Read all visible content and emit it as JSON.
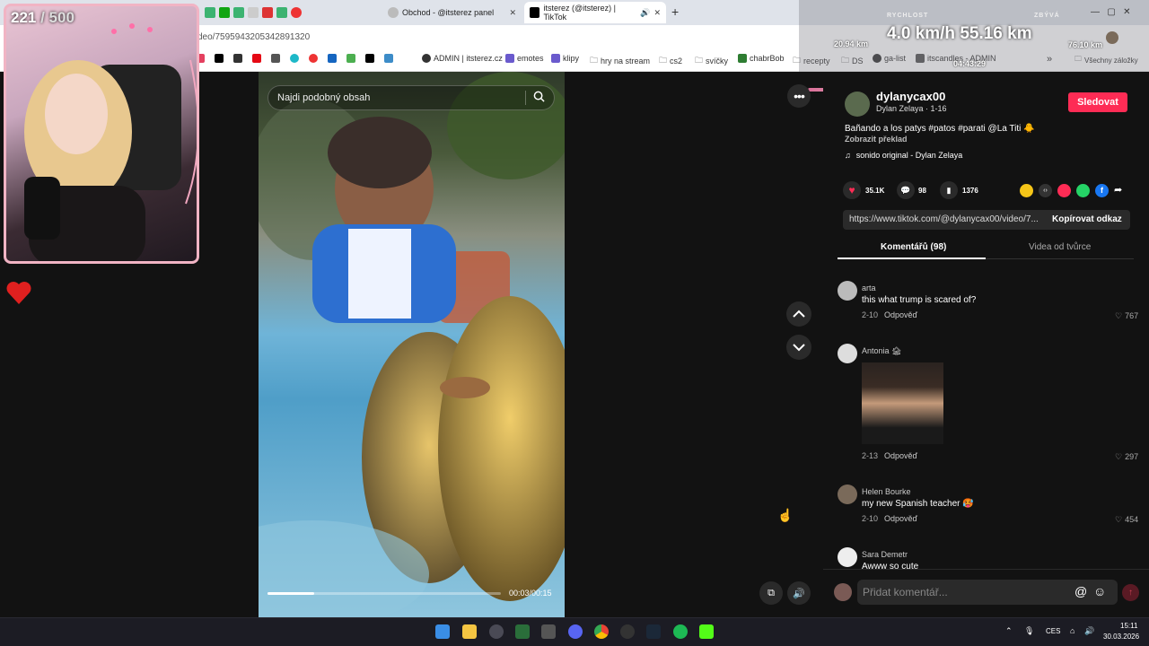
{
  "overlay": {
    "counter_current": "221",
    "counter_total": "/ 500",
    "speed_label": "RYCHLOST",
    "remaining_label": "ZBÝVÁ",
    "speed_value": "4.0 km/h 55.16 km",
    "distance_left": "20.94 km",
    "distance_right": "76.10 km",
    "elapsed": "04:43:29"
  },
  "browser": {
    "tabs": [
      {
        "label": "Obchod - @itsterez panel"
      },
      {
        "label": "itsterez (@itsterez) | TikTok"
      }
    ],
    "url": "deo/7595943205342891320",
    "bookmarks": [
      "ADMIN | itsterez.cz",
      "emotes",
      "klipy",
      "hry na stream",
      "cs2",
      "svíčky",
      "chabrBob",
      "recepty",
      "DS",
      "ga-list",
      "itscandles - ADMIN",
      "Všechny záložky"
    ],
    "more_label": "»"
  },
  "video": {
    "search_placeholder": "Najdi podobný obsah",
    "time": "00:03/00:15",
    "progress": 0.2
  },
  "post": {
    "username": "dylanycax00",
    "display_name": "Dylan Zelaya · 1-16",
    "follow_label": "Sledovat",
    "caption": "Bañando a los patys #patos #parati @La Titi 🐥",
    "translate_label": "Zobrazit překlad",
    "sound": "sonido original - Dylan Zelaya",
    "likes": "35.1K",
    "comments": "98",
    "saves": "1376",
    "link": "https://www.tiktok.com/@dylanycax00/video/7...",
    "copy_label": "Kopírovat odkaz"
  },
  "tabs": {
    "comments": "Komentářů (98)",
    "creator": "Videa od tvůrce"
  },
  "comments": [
    {
      "user": "arta",
      "text": "this what trump is scared of?",
      "date": "2-10",
      "reply": "Odpověď",
      "likes": "767"
    },
    {
      "user": "Antonia 🏚",
      "text": "",
      "date": "2-13",
      "reply": "Odpověď",
      "likes": "297"
    },
    {
      "user": "Helen Bourke",
      "text": "my new Spanish teacher 🥵",
      "date": "2-10",
      "reply": "Odpověď",
      "likes": "454"
    },
    {
      "user": "Sara Demetr",
      "text": "Awww so cute",
      "date": "",
      "reply": "",
      "likes": ""
    }
  ],
  "comment_input": {
    "placeholder": "Přidat komentář..."
  },
  "taskbar": {
    "lang": "CES",
    "time": "15:11",
    "date": "30.03.2026"
  },
  "icons": {
    "search": "search-icon",
    "more": "more-icon",
    "up": "chevron-up-icon",
    "down": "chevron-down-icon",
    "heart": "heart-icon",
    "comment": "comment-icon",
    "bookmark": "bookmark-icon",
    "share": "share-icon",
    "music": "music-note-icon",
    "mention": "at-icon",
    "emoji": "emoji-icon",
    "send": "send-icon"
  },
  "colors": {
    "accent": "#fe2c55",
    "panel": "#121212",
    "pink_frame": "#f1b4c4"
  }
}
